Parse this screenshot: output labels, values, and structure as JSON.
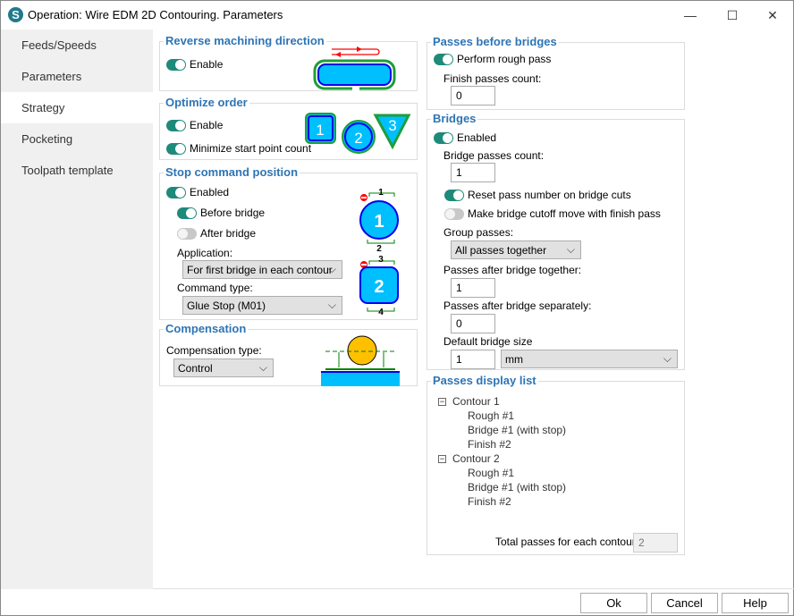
{
  "window": {
    "title": "Operation: Wire EDM 2D Contouring. Parameters",
    "minimize": "—",
    "maximize": "☐",
    "close": "✕"
  },
  "sidebar": {
    "items": [
      {
        "label": "Feeds/Speeds"
      },
      {
        "label": "Parameters"
      },
      {
        "label": "Strategy",
        "selected": true
      },
      {
        "label": "Pocketing"
      },
      {
        "label": "Toolpath template"
      }
    ]
  },
  "reverse": {
    "title": "Reverse machining direction",
    "enable": "Enable",
    "enable_on": true
  },
  "optimize": {
    "title": "Optimize order",
    "enable": "Enable",
    "minimize": "Minimize start point count",
    "icons": [
      "1",
      "2",
      "3"
    ]
  },
  "stop": {
    "title": "Stop command position",
    "enabled": "Enabled",
    "before": "Before bridge",
    "after": "After bridge",
    "application_label": "Application:",
    "application_value": "For first bridge in each contour",
    "command_label": "Command type:",
    "command_value": "Glue Stop (M01)",
    "diagram": [
      "1",
      "2",
      "3",
      "4"
    ]
  },
  "compensation": {
    "title": "Compensation",
    "type_label": "Compensation type:",
    "type_value": "Control"
  },
  "passes_before": {
    "title": "Passes before bridges",
    "rough": "Perform rough pass",
    "finish_label": "Finish passes count:",
    "finish_value": "0"
  },
  "bridges": {
    "title": "Bridges",
    "enabled": "Enabled",
    "count_label": "Bridge passes count:",
    "count_value": "1",
    "reset": "Reset pass number on bridge cuts",
    "reset_on": true,
    "cutoff": "Make bridge cutoff move with finish pass",
    "cutoff_on": false,
    "group_label": "Group passes:",
    "group_value": "All passes together",
    "together_label": "Passes after bridge together:",
    "together_value": "1",
    "separately_label": "Passes after bridge separately:",
    "separately_value": "0",
    "size_label": "Default bridge size",
    "size_value": "1",
    "unit": "mm"
  },
  "display": {
    "title": "Passes display list",
    "contours": [
      {
        "name": "Contour 1",
        "children": [
          "Rough #1",
          "Bridge #1 (with stop)",
          "Finish #2"
        ]
      },
      {
        "name": "Contour 2",
        "children": [
          "Rough #1",
          "Bridge #1 (with stop)",
          "Finish #2"
        ]
      }
    ],
    "total_label": "Total passes for each contour:",
    "total_value": "2"
  },
  "footer": {
    "ok": "Ok",
    "cancel": "Cancel",
    "help": "Help"
  },
  "colors": {
    "accent": "#2e74b5",
    "toggle_on": "#1e8a7a",
    "diagram_fill": "#00bfff",
    "diagram_border": "#0000ee",
    "diagram_outline": "#1e9e3a"
  }
}
